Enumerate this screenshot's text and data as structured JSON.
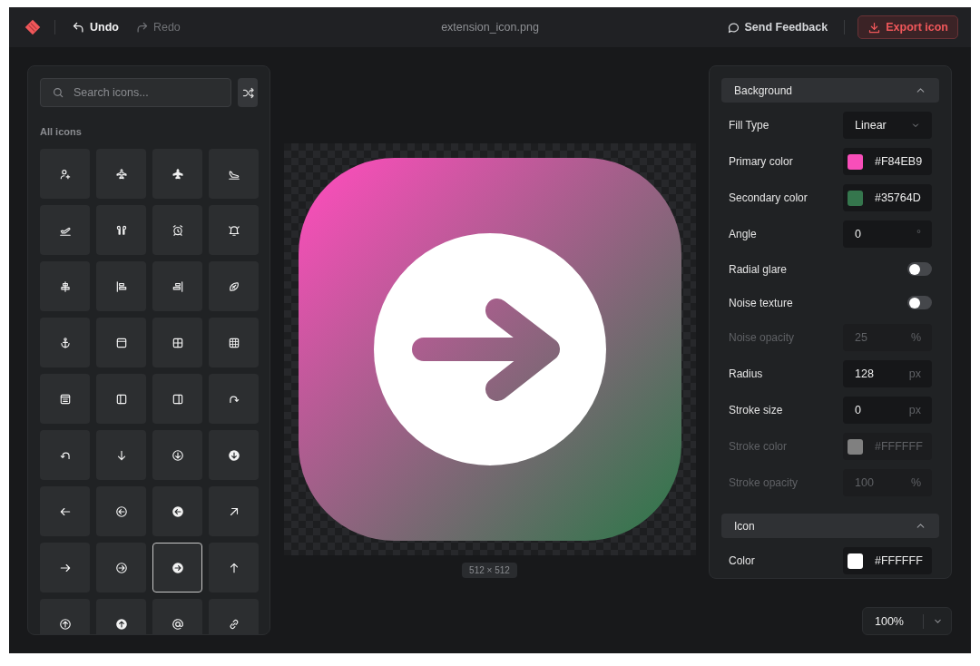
{
  "topbar": {
    "undo": {
      "label": "Undo",
      "disabled": false
    },
    "redo": {
      "label": "Redo",
      "disabled": true
    },
    "file_name": "extension_icon.png",
    "feedback": "Send Feedback",
    "export": "Export icon"
  },
  "library": {
    "search": {
      "placeholder": "Search icons..."
    },
    "section_label": "All icons",
    "icons": [
      {
        "selected": false
      },
      {
        "selected": false
      },
      {
        "selected": false
      },
      {
        "selected": false
      },
      {
        "selected": false
      },
      {
        "selected": false
      },
      {
        "selected": false
      },
      {
        "selected": false
      },
      {
        "selected": false
      },
      {
        "selected": false
      },
      {
        "selected": false
      },
      {
        "selected": false
      },
      {
        "selected": false
      },
      {
        "selected": false
      },
      {
        "selected": false
      },
      {
        "selected": false
      },
      {
        "selected": false
      },
      {
        "selected": false
      },
      {
        "selected": false
      },
      {
        "selected": false
      },
      {
        "selected": false
      },
      {
        "selected": false
      },
      {
        "selected": false
      },
      {
        "selected": false
      },
      {
        "selected": false
      },
      {
        "selected": false
      },
      {
        "selected": false
      },
      {
        "selected": false
      },
      {
        "selected": false
      },
      {
        "selected": false
      },
      {
        "selected": true
      },
      {
        "selected": false
      },
      {
        "selected": false
      },
      {
        "selected": false
      },
      {
        "selected": false
      },
      {
        "selected": false
      }
    ]
  },
  "canvas": {
    "size_label": "512 × 512"
  },
  "settings": [
    {
      "title": "Background",
      "expanded": true,
      "items": [
        {
          "kind": "select",
          "label": "Fill Type",
          "value": "Linear",
          "disabled": false
        },
        {
          "kind": "color",
          "label": "Primary color",
          "value": "#F84EB9",
          "color": "#f84eb9",
          "disabled": false
        },
        {
          "kind": "color",
          "label": "Secondary color",
          "value": "#35764D",
          "color": "#35764d",
          "disabled": false
        },
        {
          "kind": "number",
          "label": "Angle",
          "value": "0",
          "unit": "°",
          "disabled": false
        },
        {
          "kind": "toggle",
          "label": "Radial glare",
          "on": false,
          "disabled": false
        },
        {
          "kind": "toggle",
          "label": "Noise texture",
          "on": false,
          "disabled": false
        },
        {
          "kind": "number",
          "label": "Noise opacity",
          "value": "25",
          "unit": "%",
          "disabled": true
        },
        {
          "kind": "number",
          "label": "Radius",
          "value": "128",
          "unit": "px",
          "disabled": false
        },
        {
          "kind": "number",
          "label": "Stroke size",
          "value": "0",
          "unit": "px",
          "disabled": false
        },
        {
          "kind": "color",
          "label": "Stroke color",
          "value": "#FFFFFF",
          "color": "#808080",
          "disabled": true
        },
        {
          "kind": "number",
          "label": "Stroke opacity",
          "value": "100",
          "unit": "%",
          "disabled": true
        }
      ]
    },
    {
      "title": "Icon",
      "expanded": true,
      "items": [
        {
          "kind": "color",
          "label": "Color",
          "value": "#FFFFFF",
          "color": "#ffffff",
          "disabled": false
        }
      ]
    }
  ],
  "zoom": {
    "value": "100%"
  }
}
